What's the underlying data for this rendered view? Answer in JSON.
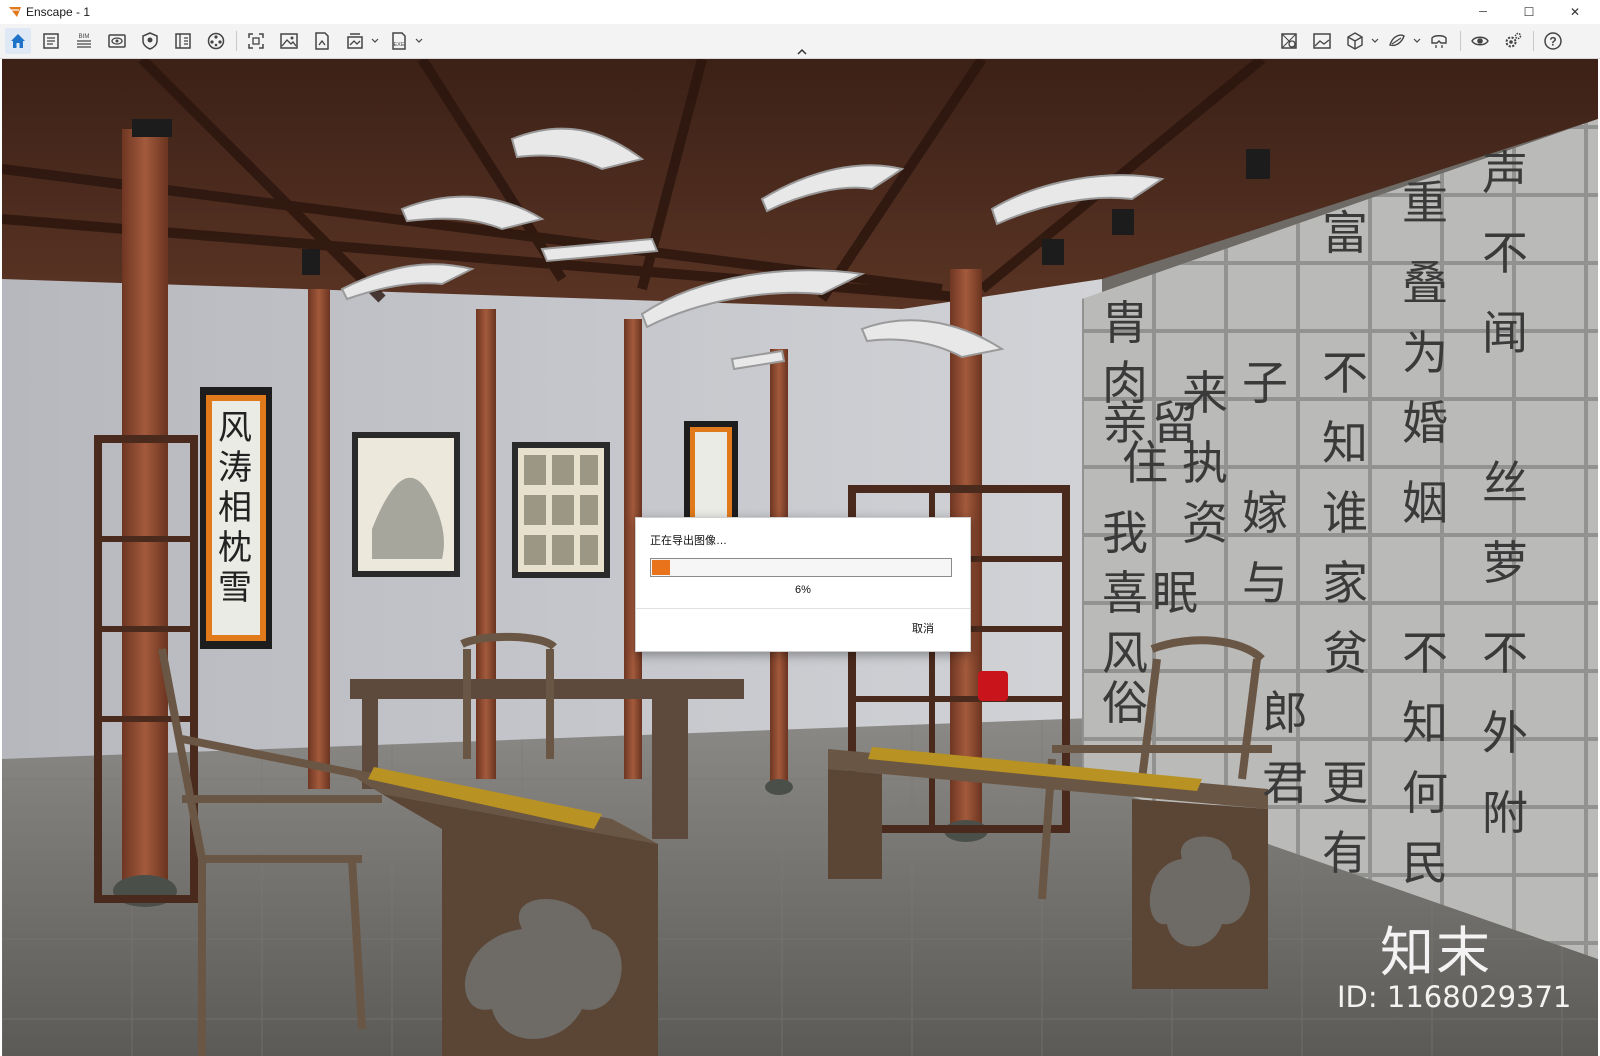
{
  "window": {
    "title": "Enscape - 1",
    "minimize_glyph": "─",
    "maximize_glyph": "☐",
    "close_glyph": "✕"
  },
  "toolbar": {
    "left_icons": [
      "home-icon",
      "documents-icon",
      "bim-icon",
      "visual-settings-icon",
      "shield-icon",
      "book-icon",
      "film-icon",
      "screenshot-icon",
      "image-icon",
      "export-image-icon",
      "batch-render-icon",
      "exe-export-icon"
    ],
    "right_icons": [
      "site-context-icon",
      "gallery-icon",
      "cube-icon",
      "material-icon",
      "vr-headset-icon",
      "view-icon",
      "settings-icon",
      "help-icon"
    ],
    "bim_label": "BIM",
    "exe_label": "EXE",
    "help_glyph": "?",
    "collapse_glyph": "⌃"
  },
  "dialog": {
    "message": "正在导出图像…",
    "progress_percent": 6,
    "progress_label": "6%",
    "cancel_label": "取消"
  },
  "scene": {
    "description_colors": {
      "ceiling": "#4a2a1c",
      "wall": "#c4c6cc",
      "floor": "#6a6865",
      "column": "#8a4a32",
      "stone_wall": "#b8b8b6"
    }
  },
  "watermark": {
    "logo_text": "知末",
    "id_text": "ID: 1168029371"
  }
}
